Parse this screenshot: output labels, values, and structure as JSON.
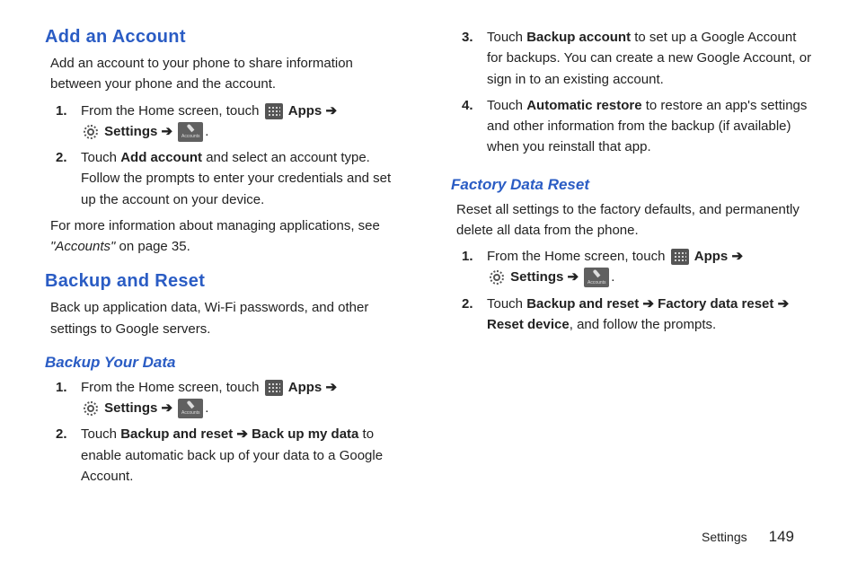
{
  "arrow": "➔",
  "left": {
    "addAccount": {
      "title": "Add an Account",
      "intro": "Add an account to your phone to share information between your phone and the account.",
      "step1_a": "From the Home screen, touch ",
      "apps": "Apps",
      "settings": "Settings",
      "period": ".",
      "step2_a": "Touch ",
      "step2_b": "Add account",
      "step2_c": " and select an account type. Follow the prompts to enter your credentials and set up the account on your device.",
      "more_a": "For more information about managing applications, see ",
      "more_b": "\"Accounts\"",
      "more_c": " on page 35."
    },
    "backupReset": {
      "title": "Backup and Reset",
      "intro": "Back up application data, Wi-Fi passwords, and other settings to Google servers."
    },
    "backupData": {
      "title": "Backup Your Data",
      "step1_a": "From the Home screen, touch ",
      "apps": "Apps",
      "settings": "Settings",
      "period": ".",
      "step2_a": "Touch ",
      "step2_b": "Backup and reset",
      "step2_c": "Back up my data",
      "step2_d": " to enable automatic back up of your data to a Google Account."
    }
  },
  "right": {
    "step3_a": "Touch ",
    "step3_b": "Backup account",
    "step3_c": " to set up a Google Account for backups. You can create a new Google Account, or sign in to an existing account.",
    "step4_a": "Touch ",
    "step4_b": "Automatic restore",
    "step4_c": " to restore an app's settings and other information from the backup (if available) when you reinstall that app.",
    "factory": {
      "title": "Factory Data Reset",
      "intro": "Reset all settings to the factory defaults, and permanently delete all data from the phone.",
      "step1_a": "From the Home screen, touch ",
      "apps": "Apps",
      "settings": "Settings",
      "period": ".",
      "step2_a": "Touch ",
      "step2_b": "Backup and reset",
      "step2_c": "Factory data reset",
      "step2_d": "Reset device",
      "step2_e": ", and follow the prompts."
    }
  },
  "footer": {
    "section": "Settings",
    "page": "149"
  },
  "nums": {
    "n1": "1.",
    "n2": "2.",
    "n3": "3.",
    "n4": "4."
  }
}
